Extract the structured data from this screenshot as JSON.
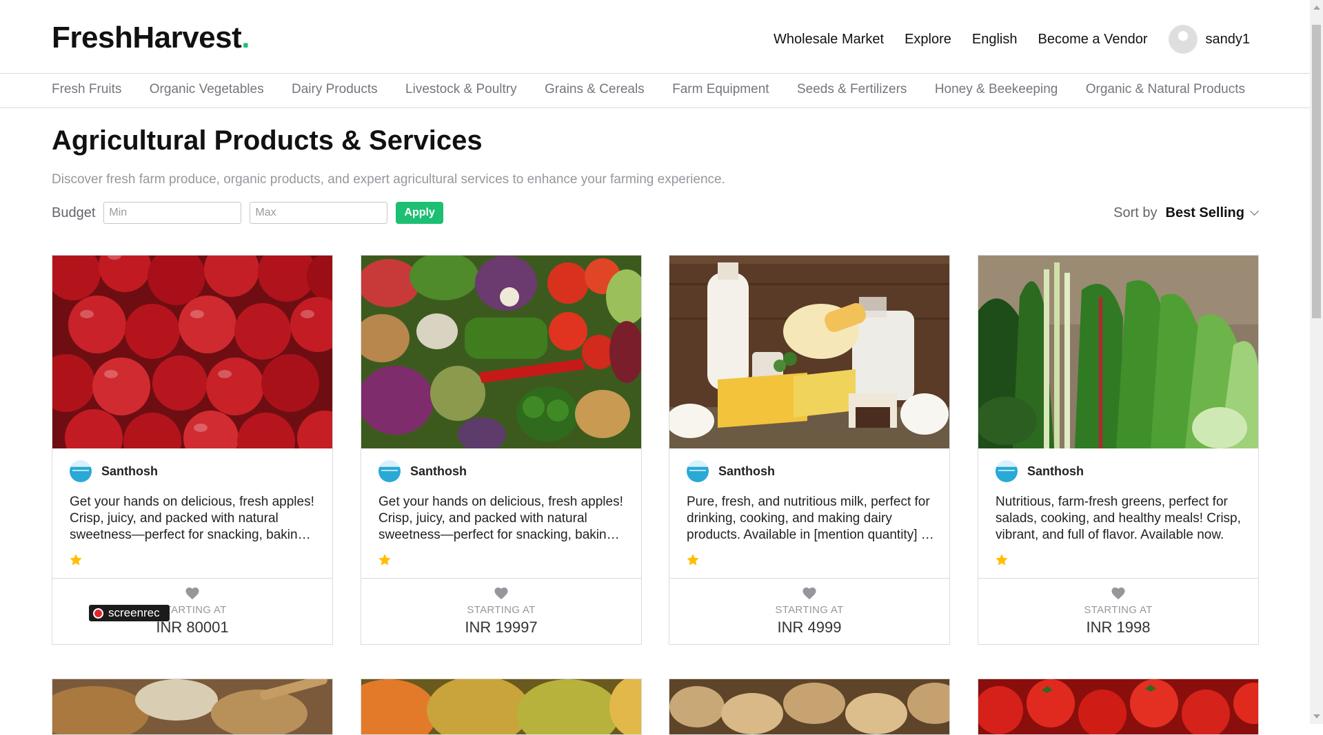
{
  "brand": {
    "name": "FreshHarvest",
    "dot": "."
  },
  "topnav": {
    "links": [
      "Wholesale Market",
      "Explore",
      "English",
      "Become a Vendor"
    ],
    "username": "sandy1"
  },
  "categories": [
    "Fresh Fruits",
    "Organic Vegetables",
    "Dairy Products",
    "Livestock & Poultry",
    "Grains & Cereals",
    "Farm Equipment",
    "Seeds & Fertilizers",
    "Honey & Beekeeping",
    "Organic & Natural Products"
  ],
  "page": {
    "title": "Agricultural Products & Services",
    "subtitle": "Discover fresh farm produce, organic products, and expert agricultural services to enhance your farming experience."
  },
  "filters": {
    "budget_label": "Budget",
    "min_placeholder": "Min",
    "max_placeholder": "Max",
    "apply_label": "Apply",
    "sort_label": "Sort by",
    "sort_value": "Best Selling"
  },
  "products": [
    {
      "seller": "Santhosh",
      "description": "Get your hands on delicious, fresh apples! Crisp, juicy, and packed with natural sweetness—perfect for snacking, baking, or juicing.",
      "rating": 1,
      "starting_label": "STARTING AT",
      "price": "INR 80001",
      "image": "apples"
    },
    {
      "seller": "Santhosh",
      "description": "Get your hands on delicious, fresh apples! Crisp, juicy, and packed with natural sweetness—perfect for snacking, baking, or juicing.",
      "rating": 1,
      "starting_label": "STARTING AT",
      "price": "INR 19997",
      "image": "mixed-vegetables"
    },
    {
      "seller": "Santhosh",
      "description": "Pure, fresh, and nutritious milk, perfect for drinking, cooking, and making dairy products. Available in [mention quantity] at the best price.",
      "rating": 1,
      "starting_label": "STARTING AT",
      "price": "INR 4999",
      "image": "dairy"
    },
    {
      "seller": "Santhosh",
      "description": "Nutritious, farm-fresh greens, perfect for salads, cooking, and healthy meals! Crisp, vibrant, and full of flavor. Available now.",
      "rating": 1,
      "starting_label": "STARTING AT",
      "price": "INR 1998",
      "image": "leafy-greens"
    }
  ],
  "next_row_images": [
    "grains",
    "mangoes",
    "potatoes",
    "tomatoes"
  ],
  "overlay": {
    "label": "screenrec"
  },
  "colors": {
    "accent": "#1dbf73",
    "star": "#ffbe00",
    "heart": "#95979d"
  }
}
